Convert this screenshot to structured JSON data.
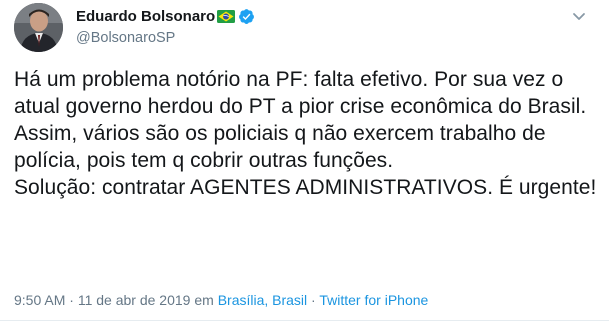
{
  "author": {
    "name": "Eduardo Bolsonaro",
    "handle": "@BolsonaroSP",
    "avatar_icon": "profile-photo",
    "flag_icon": "brazil-flag-icon",
    "verified_icon": "verified-badge-icon"
  },
  "tweet": {
    "text": "Há um problema notório na PF: falta efetivo. Por sua vez o atual governo herdou do PT a pior crise econômica do Brasil.\nAssim, vários são os policiais q não exercem trabalho de polícia, pois tem q cobrir outras funções.\nSolução: contratar AGENTES ADMINISTRATIVOS. É urgente!"
  },
  "meta": {
    "time": "9:50 AM",
    "sep1": " · ",
    "date": "11 de abr de 2019",
    "in_label": " em ",
    "location": "Brasília, Brasil",
    "sep2": " · ",
    "source": "Twitter for iPhone"
  },
  "colors": {
    "text": "#14171a",
    "secondary": "#657786",
    "link": "#1b95e0",
    "verified": "#1da1f2"
  }
}
